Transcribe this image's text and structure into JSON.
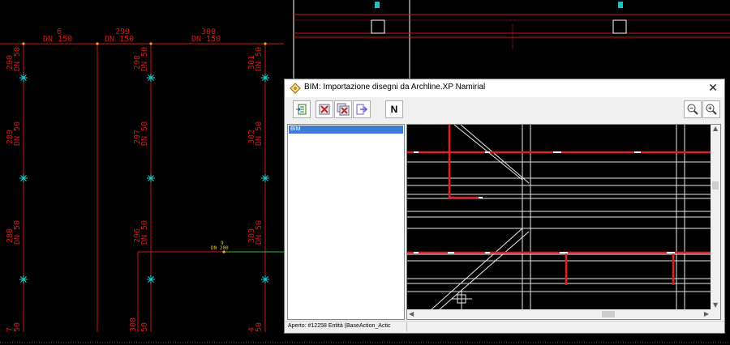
{
  "cad": {
    "labels": [
      {
        "text": "6",
        "role": "pipe-number"
      },
      {
        "text": "DN 150",
        "role": "pipe-diameter"
      },
      {
        "text": "299",
        "role": "pipe-number"
      },
      {
        "text": "DN 150",
        "role": "pipe-diameter"
      },
      {
        "text": "300",
        "role": "pipe-number"
      },
      {
        "text": "DN 150",
        "role": "pipe-diameter"
      },
      {
        "text": "290",
        "role": "riser-number"
      },
      {
        "text": "DN 50",
        "role": "riser-diameter"
      },
      {
        "text": "298",
        "role": "riser-number"
      },
      {
        "text": "DN 50",
        "role": "riser-diameter"
      },
      {
        "text": "301",
        "role": "riser-number"
      },
      {
        "text": "DN 50",
        "role": "riser-diameter"
      },
      {
        "text": "289",
        "role": "riser-number"
      },
      {
        "text": "DN 50",
        "role": "riser-diameter"
      },
      {
        "text": "297",
        "role": "riser-number"
      },
      {
        "text": "DN 50",
        "role": "riser-diameter"
      },
      {
        "text": "302",
        "role": "riser-number"
      },
      {
        "text": "DN 50",
        "role": "riser-diameter"
      },
      {
        "text": "288",
        "role": "riser-number"
      },
      {
        "text": "DN 50",
        "role": "riser-diameter"
      },
      {
        "text": "296",
        "role": "riser-number"
      },
      {
        "text": "DN 50",
        "role": "riser-diameter"
      },
      {
        "text": "303",
        "role": "riser-number"
      },
      {
        "text": "DN 50",
        "role": "riser-diameter"
      },
      {
        "text": "7",
        "role": "riser-number"
      },
      {
        "text": "50",
        "role": "riser-diameter"
      },
      {
        "text": "300",
        "role": "riser-number"
      },
      {
        "text": "50",
        "role": "riser-diameter"
      },
      {
        "text": "4",
        "role": "riser-number"
      },
      {
        "text": "50",
        "role": "riser-diameter"
      },
      {
        "text": "9",
        "role": "pipe-number"
      },
      {
        "text": "DN 200",
        "role": "pipe-diameter"
      }
    ]
  },
  "dialog": {
    "title": "BIM: Importazione disegni da Archline.XP Namirial",
    "close_glyph": "✕",
    "toolbar": {
      "n_label": "N"
    },
    "tree": {
      "items": [
        {
          "label": "BIM"
        }
      ]
    },
    "status": {
      "text": "Aperto: #12258 Entità (BaseAction_Actic"
    }
  },
  "colors": {
    "cad_line": "#c81818",
    "cad_background": "#000000",
    "selection": "#3d7bd6"
  }
}
